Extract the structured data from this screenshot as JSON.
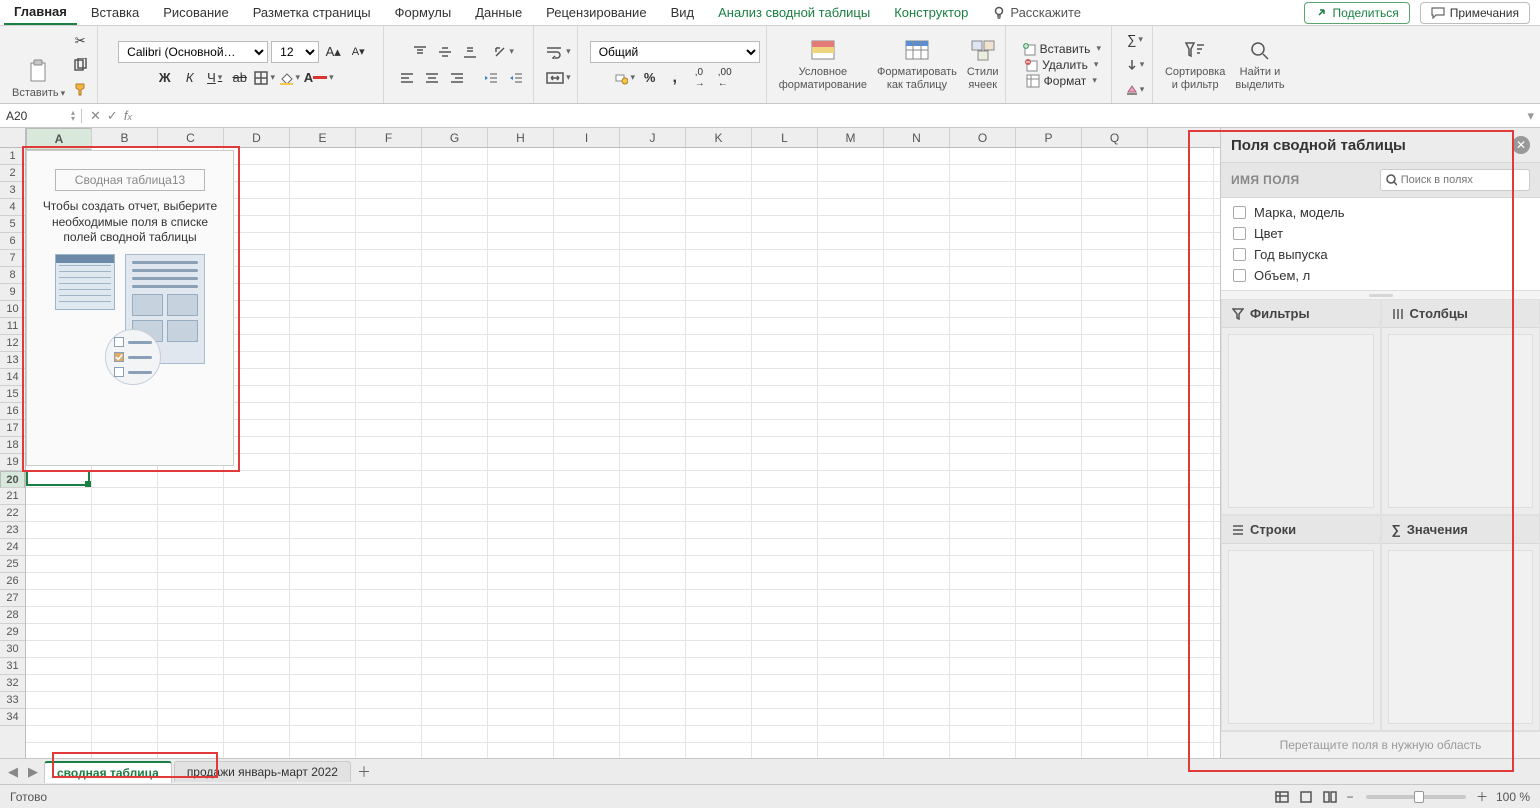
{
  "tabs": {
    "home": "Главная",
    "insert": "Вставка",
    "draw": "Рисование",
    "layout": "Разметка страницы",
    "formulas": "Формулы",
    "data": "Данные",
    "review": "Рецензирование",
    "view": "Вид",
    "pivot_analyze": "Анализ сводной таблицы",
    "design": "Конструктор",
    "tell_me": "Расскажите"
  },
  "header_buttons": {
    "share": "Поделиться",
    "comments": "Примечания"
  },
  "ribbon": {
    "paste": "Вставить",
    "font_name": "Calibri (Основной…",
    "font_size": "12",
    "number_format": "Общий",
    "cond_fmt": "Условное\nформатирование",
    "fmt_table": "Форматировать\nкак таблицу",
    "styles": "Стили\nячеек",
    "insert_cells": "Вставить",
    "delete_cells": "Удалить",
    "format_cells": "Формат",
    "sort_filter": "Сортировка\nи фильтр",
    "find_select": "Найти и\nвыделить"
  },
  "formula_bar": {
    "name_box": "A20",
    "fx": "fx"
  },
  "columns": [
    "A",
    "B",
    "C",
    "D",
    "E",
    "F",
    "G",
    "H",
    "I",
    "J",
    "K",
    "L",
    "M",
    "N",
    "O",
    "P",
    "Q"
  ],
  "row_count_visible": 34,
  "active_cell": {
    "col": 0,
    "row": 19
  },
  "pivot_placeholder": {
    "name": "Сводная таблица13",
    "help": "Чтобы создать отчет, выберите необходимые поля в списке полей сводной таблицы"
  },
  "pivot_pane": {
    "title": "Поля сводной таблицы",
    "field_name_label": "ИМЯ ПОЛЯ",
    "search_placeholder": "Поиск в полях",
    "fields": [
      "Марка, модель",
      "Цвет",
      "Год выпуска",
      "Объем, л"
    ],
    "zones": {
      "filters": "Фильтры",
      "columns": "Столбцы",
      "rows": "Строки",
      "values": "Значения"
    },
    "hint": "Перетащите поля в нужную область"
  },
  "sheet_tabs": {
    "active": "сводная таблица",
    "other": "продажи январь-март 2022"
  },
  "status": {
    "ready": "Готово",
    "zoom": "100 %"
  }
}
